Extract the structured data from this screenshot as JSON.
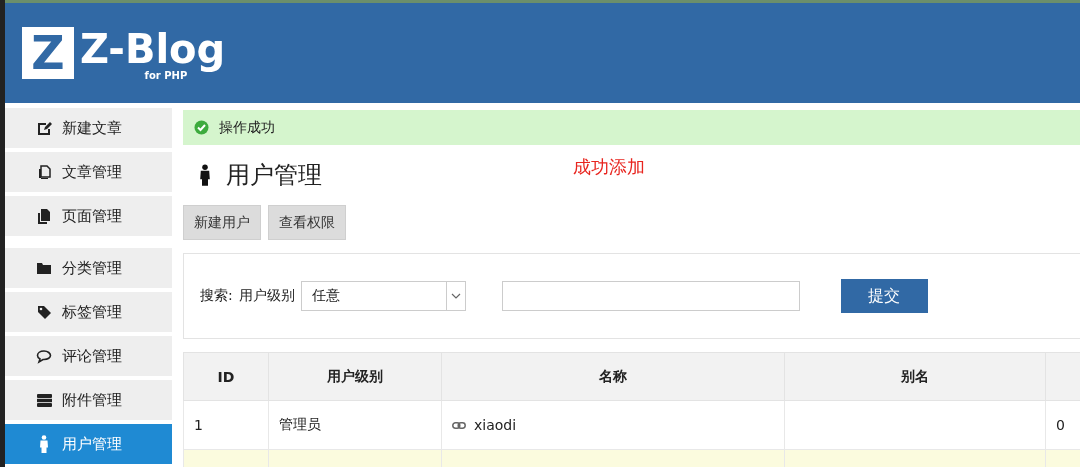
{
  "header": {
    "logo_mark": "Z",
    "logo_text": "Z-Blog",
    "logo_subtext": "for PHP"
  },
  "sidebar": {
    "groups": [
      [
        {
          "label": "新建文章",
          "kind": "edit",
          "selected": false
        },
        {
          "label": "文章管理",
          "kind": "copy",
          "selected": false
        },
        {
          "label": "页面管理",
          "kind": "file",
          "selected": false
        }
      ],
      [
        {
          "label": "分类管理",
          "kind": "folder",
          "selected": false
        },
        {
          "label": "标签管理",
          "kind": "tag",
          "selected": false
        },
        {
          "label": "评论管理",
          "kind": "comment",
          "selected": false
        },
        {
          "label": "附件管理",
          "kind": "drive",
          "selected": false
        },
        {
          "label": "用户管理",
          "kind": "user",
          "selected": true
        }
      ]
    ]
  },
  "notice": {
    "text": "操作成功"
  },
  "page_title": "用户管理",
  "annotation": "成功添加",
  "buttons": [
    "新建用户",
    "查看权限"
  ],
  "search": {
    "label": "搜索:",
    "level_label": "用户级别",
    "level_value": "任意",
    "submit": "提交"
  },
  "table": {
    "columns": [
      "ID",
      "用户级别",
      "名称",
      "别名",
      ""
    ],
    "rows": [
      {
        "cells": [
          "1",
          "管理员",
          "xiaodi",
          "",
          "0"
        ],
        "highlighted": false
      },
      {
        "cells": [
          "",
          "",
          "",
          "",
          ""
        ],
        "highlighted": true
      }
    ]
  }
}
